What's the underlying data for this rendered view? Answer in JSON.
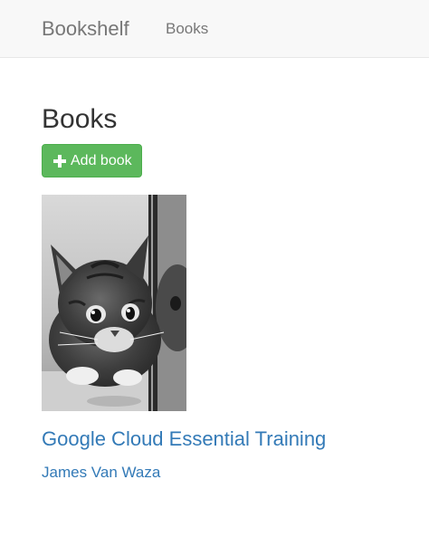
{
  "navbar": {
    "brand": "Bookshelf",
    "links": [
      {
        "label": "Books"
      }
    ]
  },
  "main": {
    "title": "Books",
    "add_button_label": "Add book",
    "add_button_icon": "plus-icon",
    "accent_colors": {
      "add_button": "#5cb85c",
      "link": "#337ab7"
    },
    "books": [
      {
        "cover_alt": "kitten-photo",
        "title": "Google Cloud Essential Training",
        "author": "James Van Waza"
      }
    ]
  }
}
